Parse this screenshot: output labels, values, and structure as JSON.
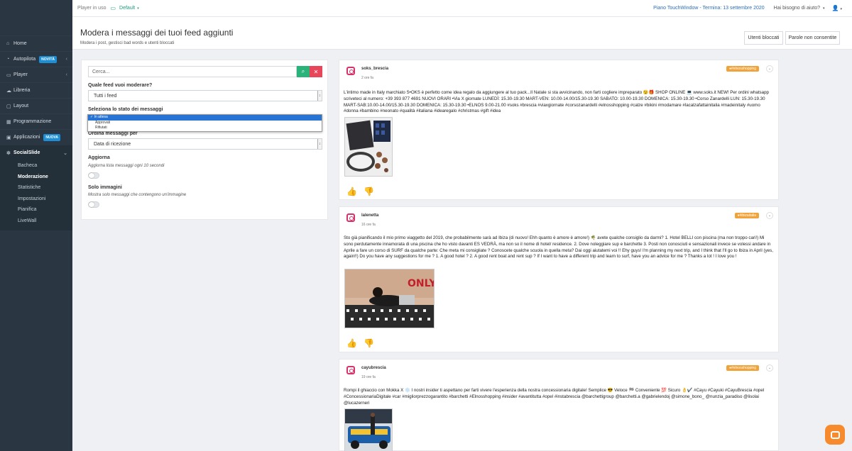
{
  "topbar": {
    "player_label": "Player in uso",
    "player_value": "Default",
    "plan": "Piano TouchWindow - Termina: 13 settembre 2020",
    "help": "Hai bisogno di aiuto?",
    "user_icon": "user-icon"
  },
  "sidebar": {
    "items": [
      {
        "label": "Home",
        "icon": "home-icon"
      },
      {
        "label": "Autopilota",
        "badge": "NOVITÀ",
        "icon": "autopilot-icon"
      },
      {
        "label": "Player",
        "icon": "monitor-icon"
      },
      {
        "label": "Libreria",
        "icon": "library-icon"
      },
      {
        "label": "Layout",
        "icon": "layout-icon"
      },
      {
        "label": "Programmazione",
        "icon": "calendar-icon"
      },
      {
        "label": "Applicazioni",
        "badge": "NUOVA",
        "icon": "apps-icon"
      }
    ],
    "group": {
      "label": "SocialSlide",
      "icon": "social-icon",
      "subitems": [
        "Bacheca",
        "Moderazione",
        "Statistiche",
        "Impostazioni",
        "Pianifica",
        "LiveWall"
      ]
    }
  },
  "header": {
    "title": "Modera i messaggi dei tuoi feed aggiunti",
    "subtitle": "Modera i post, gestisci bad words e utenti bloccati",
    "btn_blocked": "Utenti bloccati",
    "btn_words": "Parole non consentite"
  },
  "filter": {
    "search_placeholder": "Cerca...",
    "feed_label": "Quale feed vuoi moderare?",
    "feed_value": "Tutti i feed",
    "state_label": "Seleziona lo stato dei messaggi",
    "state_options": [
      "In attesa",
      "Approvati",
      "Rifiutati"
    ],
    "order_label": "Ordina messaggi per",
    "order_value": "Data di ricezione",
    "refresh_label": "Aggiorna",
    "refresh_help": "Aggiorna lista messaggi ogni 10 secondi",
    "images_label": "Solo immagini",
    "images_help": "Mostra solo messaggi che contengono un'immagine"
  },
  "posts": [
    {
      "author": "soks_brescia",
      "time": "2 ore fa",
      "tag": "#elnosshopping",
      "text": "L'intimo made in Italy marchiato S•OKS è perfetto come idea regalo da aggiungere al tuo pack...Il Natale si sta avvicinando, non farti cogliere impreparato 😉🎁 SHOP ONLINE 💻 www.soks.it NEW! Per ordini whatsapp scriveteci al numero: +39 393 877 4691 NUOVI ORARI •Via X giornate LUNEDÌ: 15.30-19.30 MART-VEN: 10.00-14.00/15.30-19.30 SABATO: 10.00-19.30 DOMENICA: 15.30-19.30 •Corso Zanardelli LUN: 15.30-19.30 MART-SAB:10.00-14.00/15.30-19.30 DOMENICA: 15.30-19.30 •ELNOS 9.00-21.00 #soks #brescia #viaxgiornate #corsozanardelli #elnosshopping #calze #bikini #modamare #lacalzafattainitalia #madeinitaly #uomo #donna #bambino #neonato #qualità #italiana #idearegalo #christmas #gift #idea"
    },
    {
      "author": "lalenetta",
      "time": "16 ore fa",
      "tag": "#ibizaitalia",
      "text": "Sto già pianificando il mio primo viaggetto del 2019, che probabilmente sarà ad Ibiza (di nuovo! Ehh quanto è amore è amore!) 🌴 avete qualche consiglio da darmi? 1. Hotel BELLI con piscina (ma non troppo cari!) Mi sono perdutamente innamorata di una piscina che ho visto davanti ES VEDRÀ, ma non so il nome di hotel/ residence. 2. Dove noleggiare sup e barchette 3. Posti non conosciuti e sensazionali invece se volessi andare in Aprile a fare un corso di SURF da qualche parte: Che meta mi consigliate ? Conoscete qualche scuola in quella meta? Dai oggi aiutatemi voi !! Ehy guys! I'm planning my next trip, and I think that I'll go to Ibiza in April (yes, again!!) Do you have any suggestions for me ? 1. A good hotel ? 2. A good rent boat and rent sup ? If I want to have a different trip and learn to surf, have you an advice for me ? Thanks a lot ! I love you !"
    },
    {
      "author": "cayubrescia",
      "time": "19 ore fa",
      "tag": "#elnosshopping",
      "text": "Rompi il ghiaccio con Mokka X ❄️ I nostri insider ti aspettano per farti vivere l'esperienza della nostra concessionaria digitale! Semplice 😎 Veloce 🏁 Conveniente 💯 Sicuro 👌✔️ #Cayu #Cayuki #CayuBrescia #opel #ConcessionariaDigitale #car #migliorprezzogarantito #barchetti #Elnosshopping #insider #avantitutta #opel #instabrescia @barchettigroup @barchetti.a @gabrielendoj @simone_bono_ @nunzia_paradiso @lisolai @lucazerneri"
    }
  ],
  "colors": {
    "sidebar": "#2a3743",
    "accent_green": "#2ab27b",
    "accent_red": "#e8445a",
    "tag": "#f0a33a",
    "link": "#2a6ebb"
  }
}
